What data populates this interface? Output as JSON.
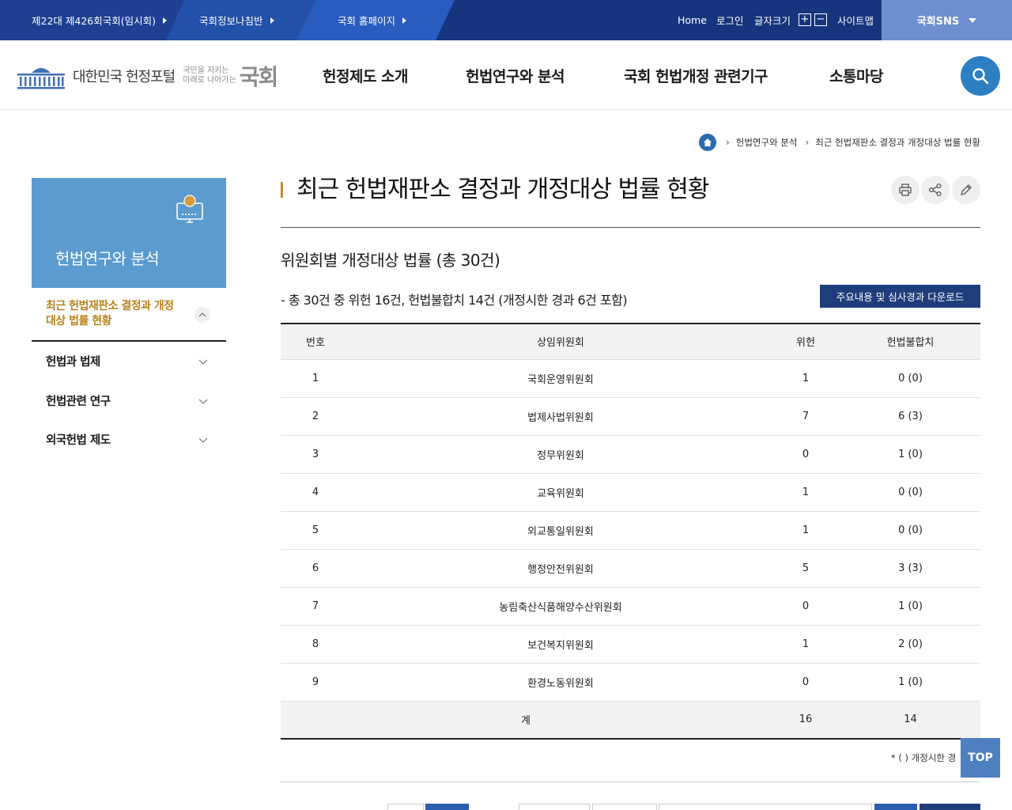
{
  "topbar": {
    "tabs": [
      "제22대 제426회국회(임시회)",
      "국회정보나침반",
      "국회 홈페이지"
    ],
    "home": "Home",
    "login": "로그인",
    "font_size": "글자크기",
    "font_plus": "+",
    "font_minus": "−",
    "sitemap": "사이트맵",
    "sns": "국회SNS"
  },
  "header": {
    "logo_name": "대한민국 헌정포털",
    "logo_slogan_1": "국민을 지키는",
    "logo_slogan_2": "미래로 나아가는",
    "logo_brand": "국회",
    "gnb": [
      "헌정제도 소개",
      "헌법연구와 분석",
      "국회 헌법개정 관련기구",
      "소통마당"
    ]
  },
  "breadcrumb": [
    "헌법연구와 분석",
    "최근 헌법재판소 결정과 개정대상 법률 현황"
  ],
  "lnb": {
    "title": "헌법연구와 분석",
    "active": "최근 헌법재판소 결정과 개정대상 법률 현황",
    "items": [
      "헌법과 법제",
      "헌법관련 연구",
      "외국헌법 제도"
    ]
  },
  "content": {
    "title": "최근 헌법재판소 결정과 개정대상 법률 현황",
    "subtitle": "위원회별 개정대상 법률 (총 30건)",
    "summary": "- 총 30건 중 위헌 16건, 헌법불합치 14건 (개정시한 경과 6건 포함)",
    "download": "주요내용 및 심사경과 다운로드",
    "table": {
      "headers": [
        "번호",
        "상임위원회",
        "위헌",
        "헌법불합치"
      ],
      "rows": [
        [
          "1",
          "국회운영위원회",
          "1",
          "0 (0)"
        ],
        [
          "2",
          "법제사법위원회",
          "7",
          "6 (3)"
        ],
        [
          "3",
          "정무위원회",
          "0",
          "1 (0)"
        ],
        [
          "4",
          "교육위원회",
          "1",
          "0 (0)"
        ],
        [
          "5",
          "외교통일위원회",
          "1",
          "0 (0)"
        ],
        [
          "6",
          "행정안전위원회",
          "5",
          "3 (3)"
        ],
        [
          "7",
          "농림축산식품해양수산위원회",
          "0",
          "1 (0)"
        ],
        [
          "8",
          "보건복지위원회",
          "1",
          "2 (0)"
        ],
        [
          "9",
          "환경노동위원회",
          "0",
          "1 (0)"
        ]
      ],
      "total": [
        "계",
        "16",
        "14"
      ]
    },
    "note": "* (    ) 개정시한 경",
    "top": "TOP"
  }
}
